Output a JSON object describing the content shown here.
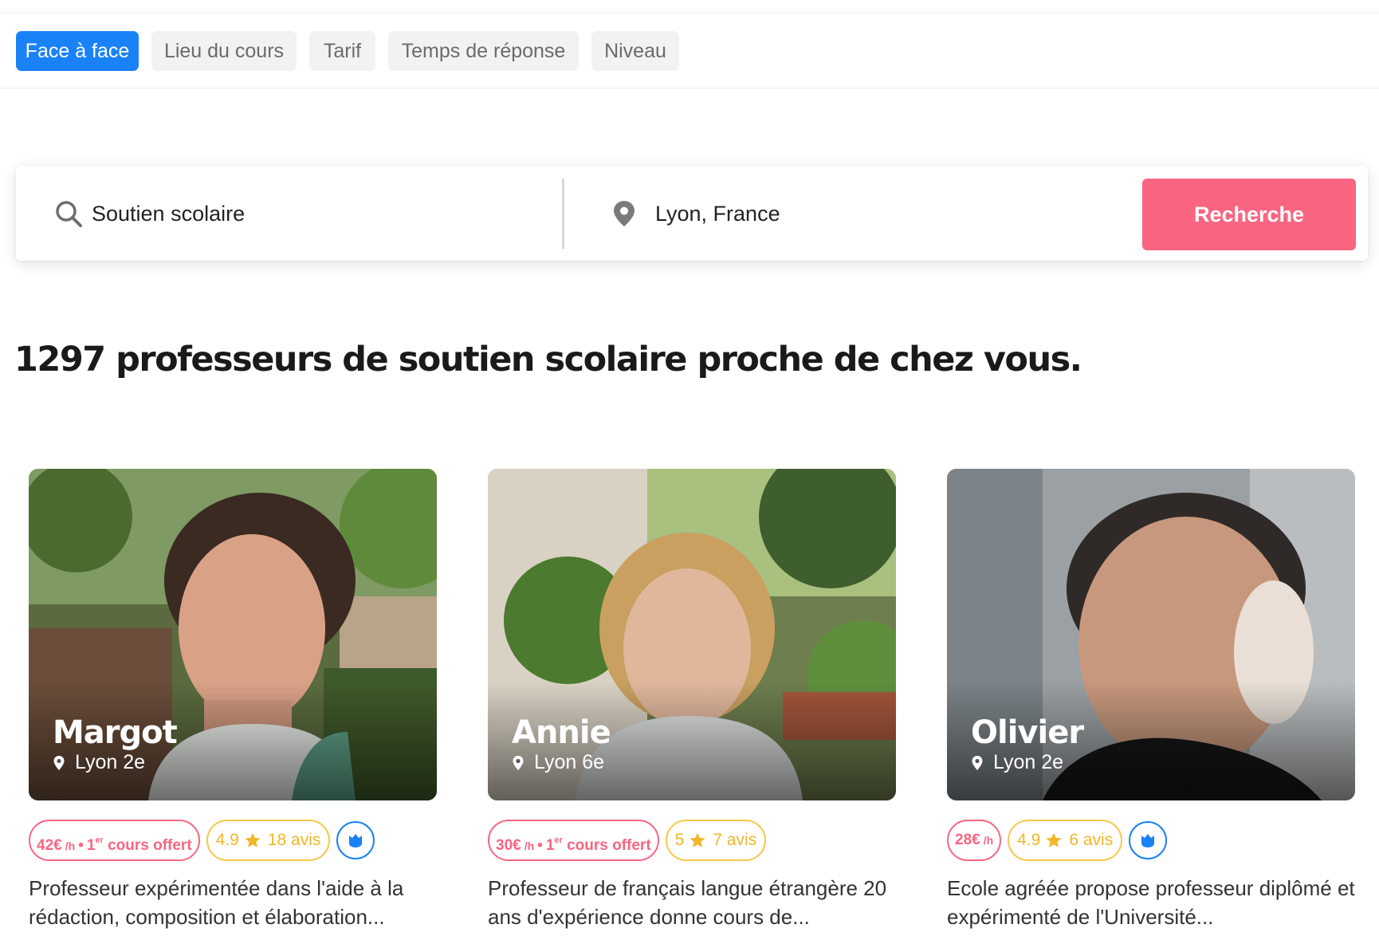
{
  "filters": [
    {
      "label": "Face à face",
      "active": true
    },
    {
      "label": "Lieu du cours",
      "active": false
    },
    {
      "label": "Tarif",
      "active": false
    },
    {
      "label": "Temps de réponse",
      "active": false
    },
    {
      "label": "Niveau",
      "active": false
    }
  ],
  "search": {
    "subject_value": "Soutien scolaire",
    "location_value": "Lyon, France",
    "button_label": "Recherche"
  },
  "results": {
    "title": "1297 professeurs de soutien scolaire proche de chez vous."
  },
  "tutors": [
    {
      "name": "Margot",
      "location": "Lyon 2e",
      "price": "42€",
      "per": "/h",
      "offer_prefix": "1",
      "offer_sup": "er",
      "offer_text": "cours offert",
      "rating": "4.9",
      "reviews": "18 avis",
      "premium": true,
      "description": "Professeur expérimentée dans l'aide à la rédaction, composition et élaboration..."
    },
    {
      "name": "Annie",
      "location": "Lyon 6e",
      "price": "30€",
      "per": "/h",
      "offer_prefix": "1",
      "offer_sup": "er",
      "offer_text": "cours offert",
      "rating": "5",
      "reviews": "7 avis",
      "premium": false,
      "description": "Professeur de français langue étrangère 20 ans d'expérience donne cours de..."
    },
    {
      "name": "Olivier",
      "location": "Lyon 2e",
      "price": "28€",
      "per": "/h",
      "rating": "4.9",
      "reviews": "6 avis",
      "premium": true,
      "description": "Ecole agréée propose professeur diplômé et expérimenté de l'Université..."
    }
  ],
  "colors": {
    "accent_blue": "#1a82f7",
    "accent_pink": "#f96581",
    "rating_gold": "#f2b629"
  },
  "icons": {
    "search": "search-icon",
    "location": "map-pin-icon",
    "star": "star-icon",
    "premium": "crown-icon"
  }
}
